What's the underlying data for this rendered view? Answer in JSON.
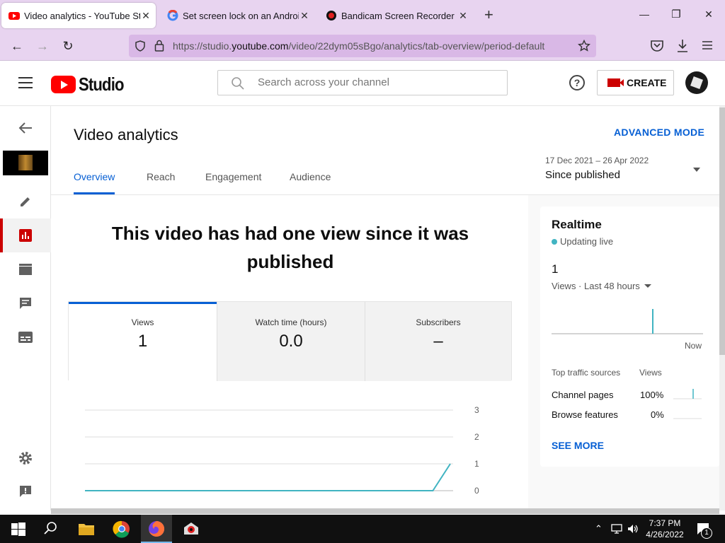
{
  "browser": {
    "tabs": [
      {
        "title": "Video analytics - YouTube Studio",
        "active": true
      },
      {
        "title": "Set screen lock on an Android device",
        "active": false
      },
      {
        "title": "Bandicam Screen Recorder Download",
        "active": false
      }
    ],
    "url_prefix": "https://studio.",
    "url_domain": "youtube.com",
    "url_path": "/video/22dym05sBgo/analytics/tab-overview/period-default"
  },
  "header": {
    "logo_text": "Studio",
    "search_placeholder": "Search across your channel",
    "create_label": "CREATE",
    "help_glyph": "?"
  },
  "page": {
    "title": "Video analytics",
    "advanced_mode": "ADVANCED MODE",
    "tabs": [
      "Overview",
      "Reach",
      "Engagement",
      "Audience"
    ],
    "date_range": "17 Dec 2021 – 26 Apr 2022",
    "period": "Since published",
    "headline": "This video has had one view since it was published"
  },
  "metrics": [
    {
      "label": "Views",
      "value": "1"
    },
    {
      "label": "Watch time (hours)",
      "value": "0.0"
    },
    {
      "label": "Subscribers",
      "value": "–"
    }
  ],
  "chart_data": {
    "type": "line",
    "title": "",
    "xlabel": "",
    "ylabel": "",
    "y_ticks": [
      "3",
      "2",
      "1",
      "0"
    ],
    "ylim": [
      0,
      3
    ],
    "series": [
      {
        "values": [
          0,
          0,
          0,
          0,
          0,
          0,
          0,
          0,
          0,
          0,
          0,
          0,
          0,
          0,
          0,
          0,
          0,
          0,
          0,
          0,
          0,
          1
        ]
      }
    ],
    "color": "#41b4c2",
    "grid": true
  },
  "realtime": {
    "title": "Realtime",
    "status": "Updating live",
    "count": "1",
    "period": "Views · Last 48 hours",
    "now_label": "Now",
    "sources_header": "Top traffic sources",
    "views_header": "Views",
    "sources": [
      {
        "name": "Channel pages",
        "pct": "100%"
      },
      {
        "name": "Browse features",
        "pct": "0%"
      }
    ],
    "see_more": "SEE MORE"
  },
  "taskbar": {
    "time": "7:37 PM",
    "date": "4/26/2022",
    "notification_count": "1"
  },
  "colors": {
    "accent": "#065fd4",
    "brand_red": "#ff0000",
    "chart_line": "#41b4c2",
    "browser_chrome": "#e8d4f0"
  }
}
